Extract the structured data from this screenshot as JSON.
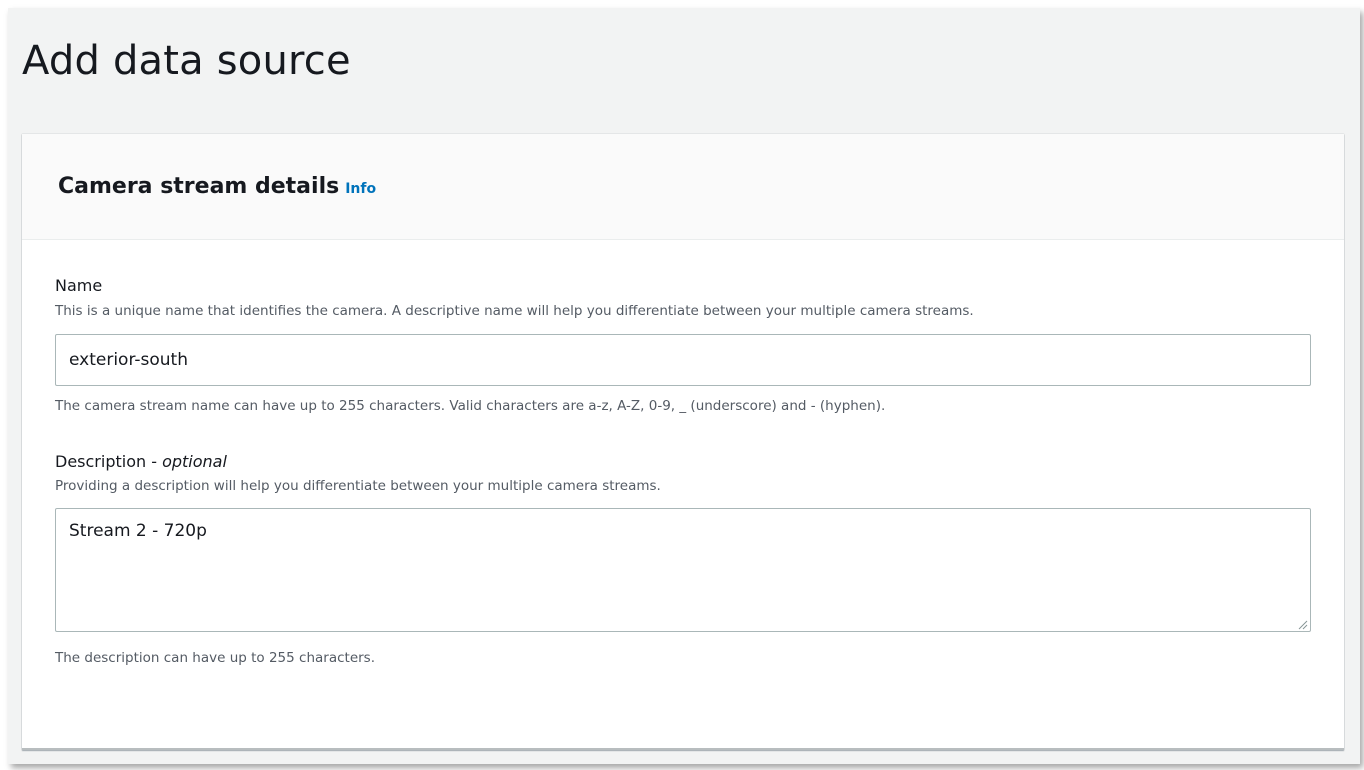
{
  "page": {
    "title": "Add data source"
  },
  "panel": {
    "title": "Camera stream details",
    "info_label": "Info"
  },
  "name_field": {
    "label": "Name",
    "description": "This is a unique name that identifies the camera. A descriptive name will help you differentiate between your multiple camera streams.",
    "value": "exterior-south",
    "constraint": "The camera stream name can have up to 255 characters. Valid characters are a-z, A-Z, 0-9, _ (underscore) and - (hyphen)."
  },
  "description_field": {
    "label": "Description - ",
    "label_optional": "optional",
    "description": "Providing a description will help you differentiate between your multiple camera streams.",
    "value": "Stream 2 - 720p",
    "constraint": "The description can have up to 255 characters."
  },
  "colors": {
    "accent_link": "#0073bb",
    "background": "#f2f3f3",
    "panel_header": "#fafafa",
    "input_border": "#aab7b8",
    "secondary_text": "#545b64"
  },
  "icons": {
    "resize": "resize-handle-icon"
  }
}
